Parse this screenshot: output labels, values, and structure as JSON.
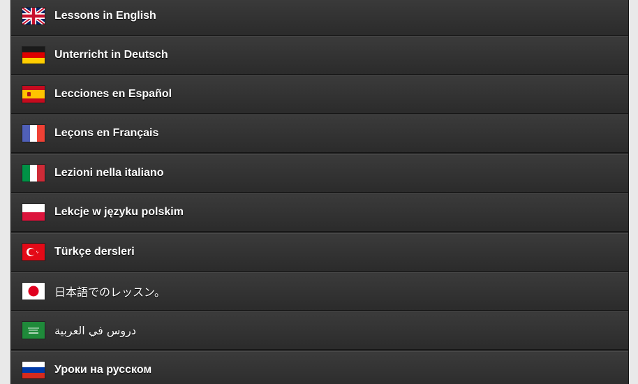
{
  "languages": [
    {
      "label": "Lessons in English",
      "flag": "uk-flag-icon"
    },
    {
      "label": "Unterricht in Deutsch",
      "flag": "germany-flag-icon"
    },
    {
      "label": "Lecciones en Español",
      "flag": "spain-flag-icon"
    },
    {
      "label": "Leçons en Français",
      "flag": "france-flag-icon"
    },
    {
      "label": "Lezioni nella italiano",
      "flag": "italy-flag-icon"
    },
    {
      "label": "Lekcje w języku polskim",
      "flag": "poland-flag-icon"
    },
    {
      "label": "Türkçe dersleri",
      "flag": "turkey-flag-icon"
    },
    {
      "label": "日本語でのレッスン。",
      "flag": "japan-flag-icon"
    },
    {
      "label": "دروس في العربية",
      "flag": "saudi-arabia-flag-icon"
    },
    {
      "label": "Уроки на русском",
      "flag": "russia-flag-icon"
    }
  ],
  "colors": {
    "row_top": "#3b3b3b",
    "row_bottom": "#2b2b2b",
    "text": "#ffffff",
    "page_bg": "#e9e9e9"
  }
}
